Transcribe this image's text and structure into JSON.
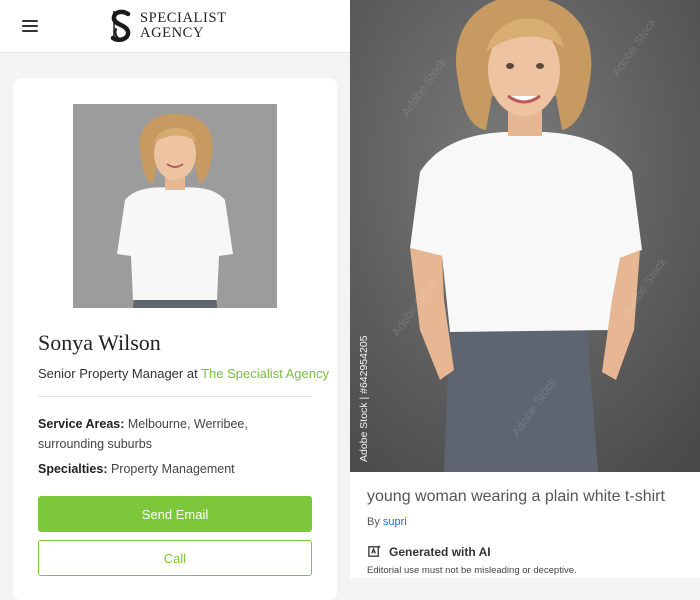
{
  "header": {
    "menu_icon": "hamburger-menu-icon",
    "logo": {
      "line1": "SPECIALIST",
      "line2": "AGENCY"
    }
  },
  "profile": {
    "name": "Sonya Wilson",
    "role_prefix": "Senior Property Manager at ",
    "agency_link": "The Specialist Agency",
    "service_areas_label": "Service Areas:",
    "service_areas_value": " Melbourne, Werribee, surrounding suburbs",
    "specialties_label": "Specialties:",
    "specialties_value": " Property Management",
    "send_email_label": "Send Email",
    "call_label": "Call"
  },
  "stock": {
    "vertical_id": "Adobe Stock | #642954205",
    "watermark": "Adobe Stock",
    "title": "young woman wearing a plain white t-shirt",
    "by_prefix": "By ",
    "author": "supri",
    "ai_label": "Generated with AI",
    "ai_icon": "ai-generated-icon",
    "editorial_note": "Editorial use must not be misleading or deceptive."
  },
  "colors": {
    "accent_green": "#7cc83a",
    "link_blue": "#1473e6"
  }
}
